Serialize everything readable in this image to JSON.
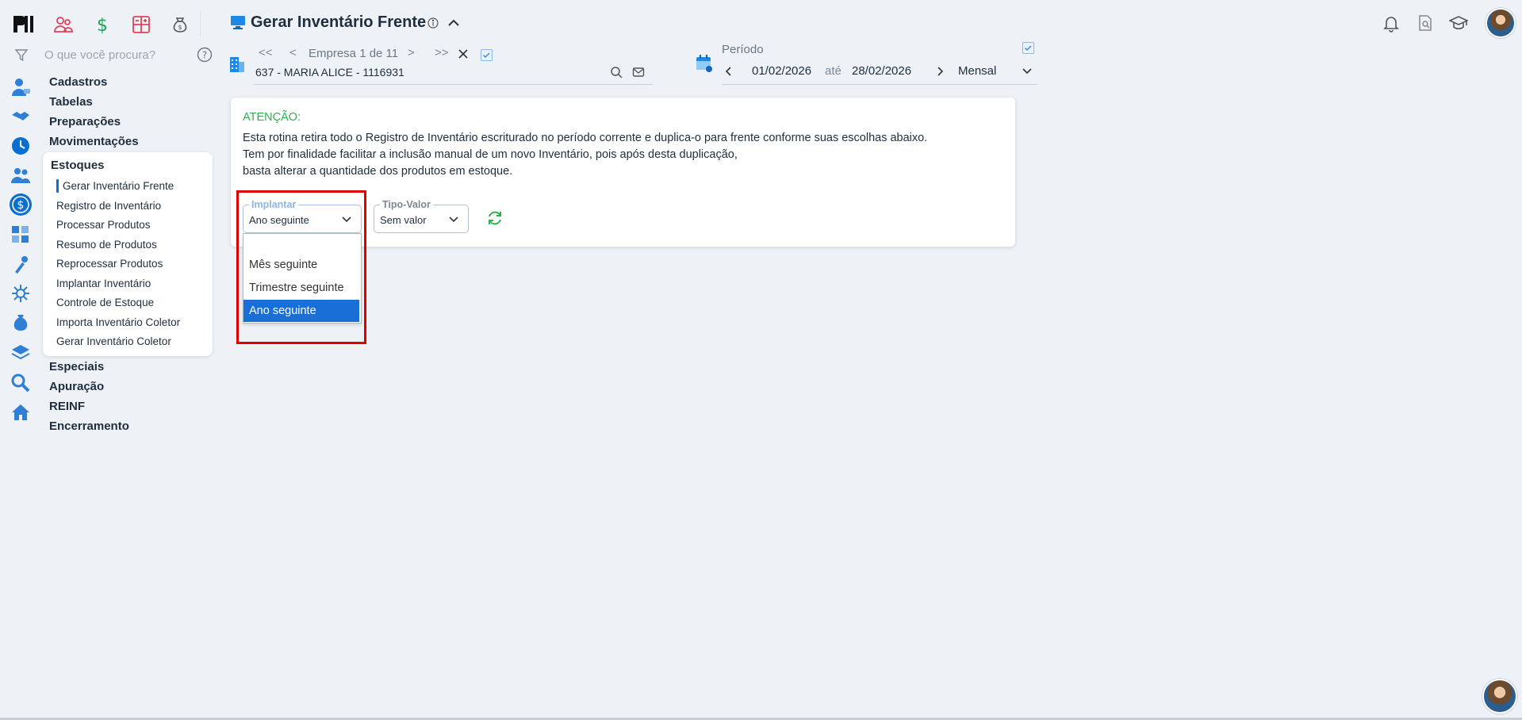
{
  "search": {
    "placeholder": "O que você procura?"
  },
  "header": {
    "title": "Gerar Inventário Frente"
  },
  "menu": {
    "sections_top": [
      "Cadastros",
      "Tabelas",
      "Preparações",
      "Movimentações"
    ],
    "expanded": {
      "title": "Estoques",
      "items": [
        "Gerar Inventário Frente",
        "Registro de Inventário",
        "Processar Produtos",
        "Resumo de Produtos",
        "Reprocessar Produtos",
        "Implantar Inventário",
        "Controle de Estoque",
        "Importa Inventário Coletor",
        "Gerar Inventário Coletor"
      ],
      "active_index": 0
    },
    "sections_bottom": [
      "Especiais",
      "Apuração",
      "REINF",
      "Encerramento"
    ]
  },
  "empresa": {
    "first": "<<",
    "prev": "<",
    "label": "Empresa 1 de 11",
    "next": ">",
    "last": ">>",
    "value": "637 - MARIA ALICE - 1116931"
  },
  "periodo": {
    "label": "Período",
    "start": "01/02/2026",
    "ate": "até",
    "end": "28/02/2026",
    "mode": "Mensal"
  },
  "attention": {
    "title": "ATENÇÃO:",
    "lines": [
      "Esta rotina retira todo o Registro de Inventário escriturado no período corrente e duplica-o para frente conforme suas escolhas abaixo.",
      "Tem por finalidade facilitar a inclusão manual de um novo Inventário, pois após desta duplicação,",
      "basta alterar a quantidade dos produtos em estoque."
    ]
  },
  "implantar": {
    "label": "Implantar",
    "value": "Ano seguinte",
    "options": [
      "Mês seguinte",
      "Trimestre seguinte",
      "Ano seguinte"
    ],
    "selected_index": 2
  },
  "tipo_valor": {
    "label": "Tipo-Valor",
    "value": "Sem valor"
  },
  "colors": {
    "accent": "#0b6fd1",
    "attention": "#2bb24c",
    "selection": "#1a6fd6",
    "highlight": "#e00000"
  },
  "icons": {
    "top": [
      "people-icon",
      "dollar-icon",
      "calculator-icon",
      "money-bag-icon"
    ],
    "rail": [
      "user-icon",
      "handshake-icon",
      "clock-icon",
      "users-icon",
      "dollar-circle-icon",
      "apps-icon",
      "tools-icon",
      "network-icon",
      "money-bag-icon",
      "layers-icon",
      "search-icon",
      "home-icon"
    ],
    "right": [
      "bell-icon",
      "document-search-icon",
      "graduation-cap-icon"
    ]
  }
}
